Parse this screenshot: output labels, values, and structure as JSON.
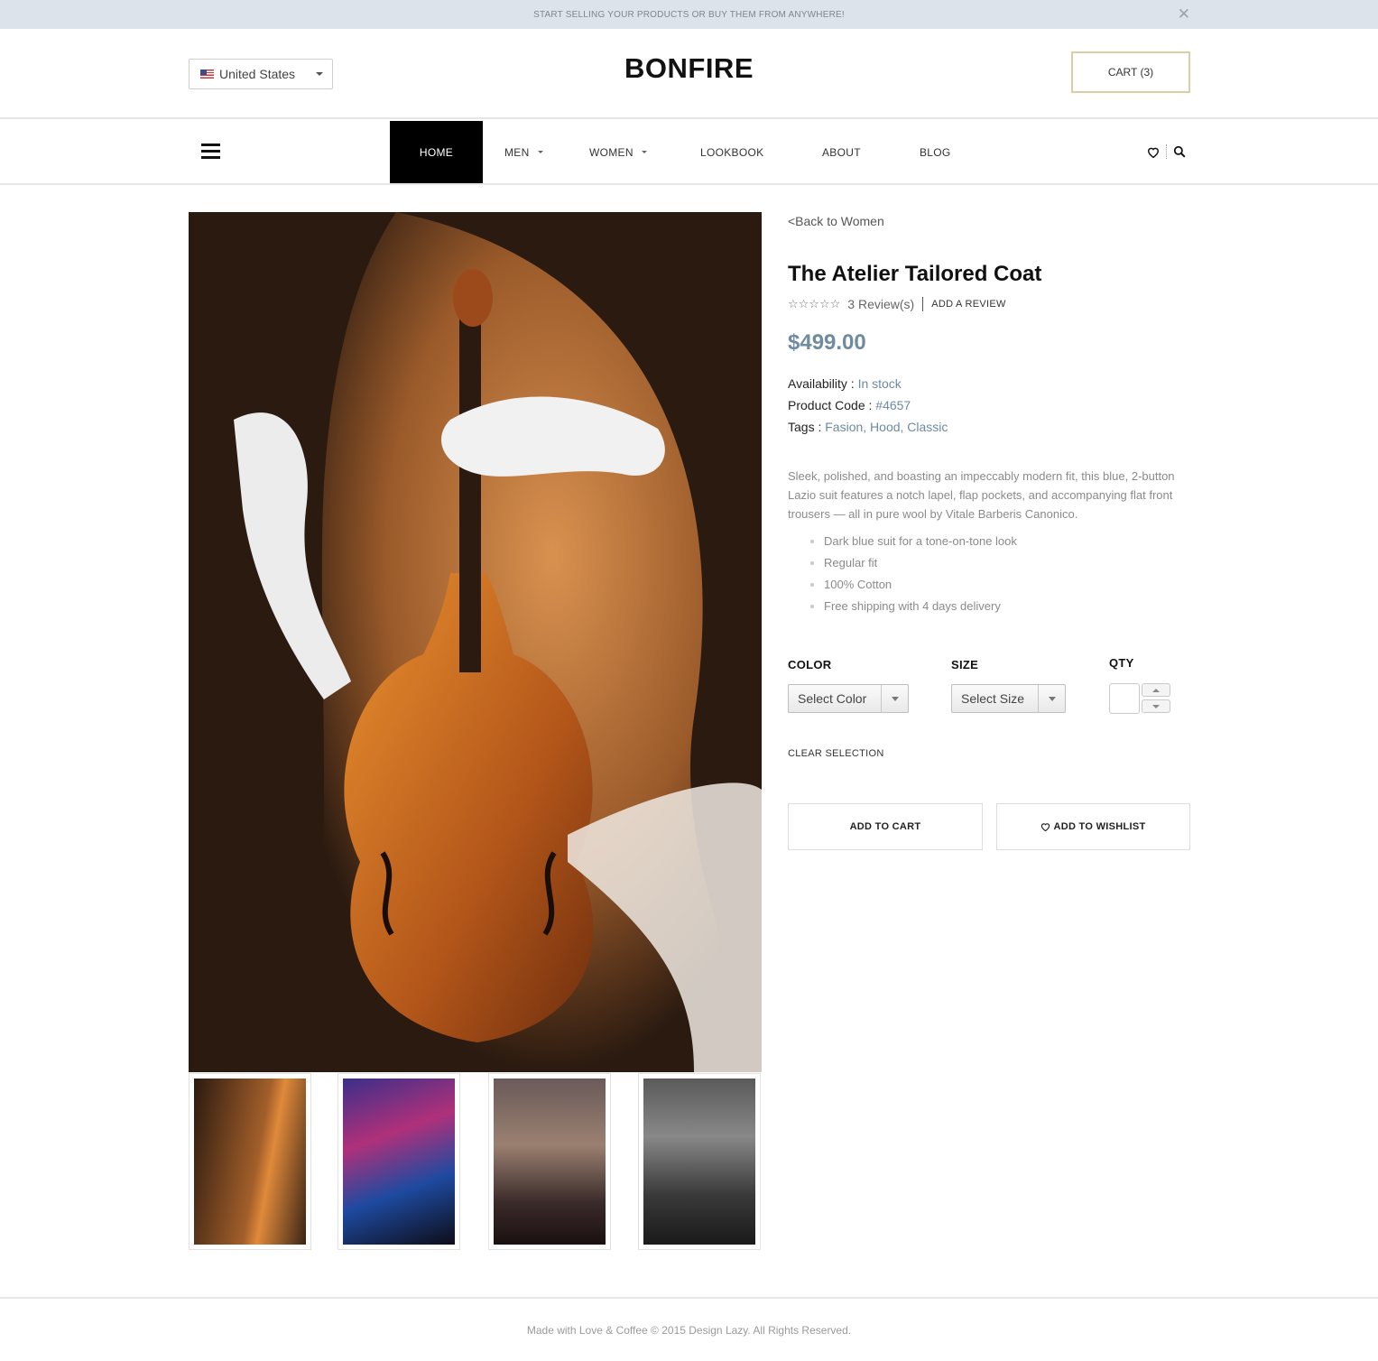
{
  "promo": {
    "text": "START SELLING YOUR PRODUCTS OR BUY THEM FROM ANYWHERE!",
    "close": "✕"
  },
  "header": {
    "country": "United States",
    "logo": "BONFIRE",
    "cart": "CART (3)"
  },
  "nav": {
    "items": [
      {
        "label": "HOME",
        "active": true
      },
      {
        "label": "MEN",
        "dropdown": true
      },
      {
        "label": "WOMEN",
        "dropdown": true
      },
      {
        "label": "LOOKBOOK"
      },
      {
        "label": "ABOUT"
      },
      {
        "label": "BLOG"
      }
    ],
    "icons": [
      "heart-icon",
      "search-icon"
    ]
  },
  "product": {
    "back": "<Back to Women",
    "title": "The Atelier Tailored Coat",
    "stars": "☆☆☆☆☆",
    "reviews": "3 Review(s)",
    "add_review": "ADD A REVIEW",
    "price": "$499.00",
    "availability_label": "Availability : ",
    "availability": "In stock",
    "code_label": "Product Code : ",
    "code": "#4657",
    "tags_label": "Tags : ",
    "tags": "Fasion, Hood, Classic",
    "description": "Sleek, polished, and boasting an impeccably modern fit, this blue, 2-button Lazio suit features a notch lapel, flap pockets, and accompanying flat front trousers — all in pure wool by Vitale Barberis Canonico.",
    "bullets": [
      "Dark blue suit for a tone-on-tone look",
      "Regular fit",
      "100% Cotton",
      "Free shipping with 4 days delivery"
    ],
    "color_label": "COLOR",
    "color_select": "Select Color",
    "size_label": "SIZE",
    "size_select": "Select Size",
    "qty_label": "QTY",
    "qty_value": "",
    "clear_selection": "CLEAR SELECTION",
    "add_to_cart": "ADD TO CART",
    "add_to_wishlist": "ADD TO WISHLIST"
  },
  "colors": {
    "accent": "#6e8ba0",
    "promo_bg": "#dde3ea",
    "cart_border": "#d9cfa6"
  },
  "footer": {
    "text": "Made with Love & Coffee © 2015 Design Lazy. All Rights Reserved."
  }
}
